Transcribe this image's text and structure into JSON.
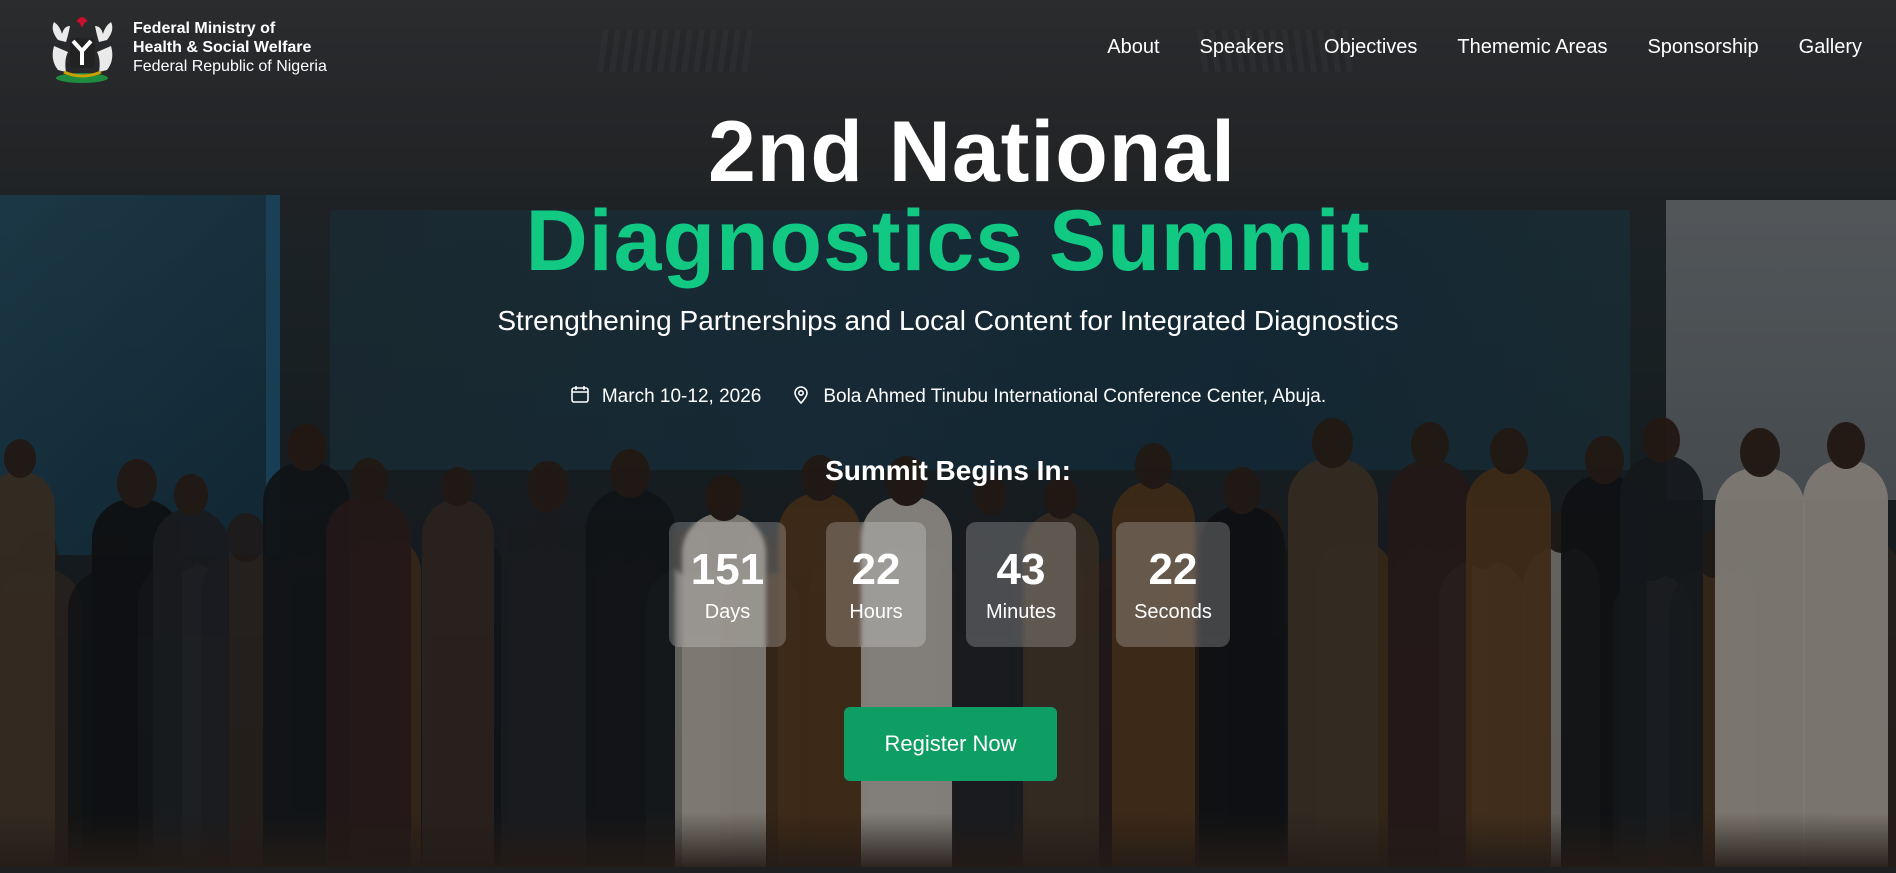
{
  "header": {
    "brand": {
      "line1": "Federal Ministry of",
      "line2": "Health & Social Welfare",
      "line3": "Federal Republic of Nigeria"
    },
    "nav": [
      "About",
      "Speakers",
      "Objectives",
      "Thememic Areas",
      "Sponsorship",
      "Gallery"
    ]
  },
  "hero": {
    "title_line1": "2nd National",
    "title_line2": "Diagnostics Summit",
    "subtitle": "Strengthening Partnerships and Local Content for Integrated Diagnostics",
    "date": "March 10-12, 2026",
    "venue": "Bola Ahmed Tinubu International Conference Center, Abuja.",
    "countdown_heading": "Summit Begins In:",
    "countdown": [
      {
        "value": "151",
        "label": "Days"
      },
      {
        "value": "22",
        "label": "Hours"
      },
      {
        "value": "43",
        "label": "Minutes"
      },
      {
        "value": "22",
        "label": "Seconds"
      }
    ],
    "cta_label": "Register Now"
  },
  "colors": {
    "accent_green": "#11c983",
    "button_green": "#0e9d63"
  },
  "icons": [
    "coat-of-arms-logo",
    "calendar-icon",
    "location-pin-icon"
  ]
}
